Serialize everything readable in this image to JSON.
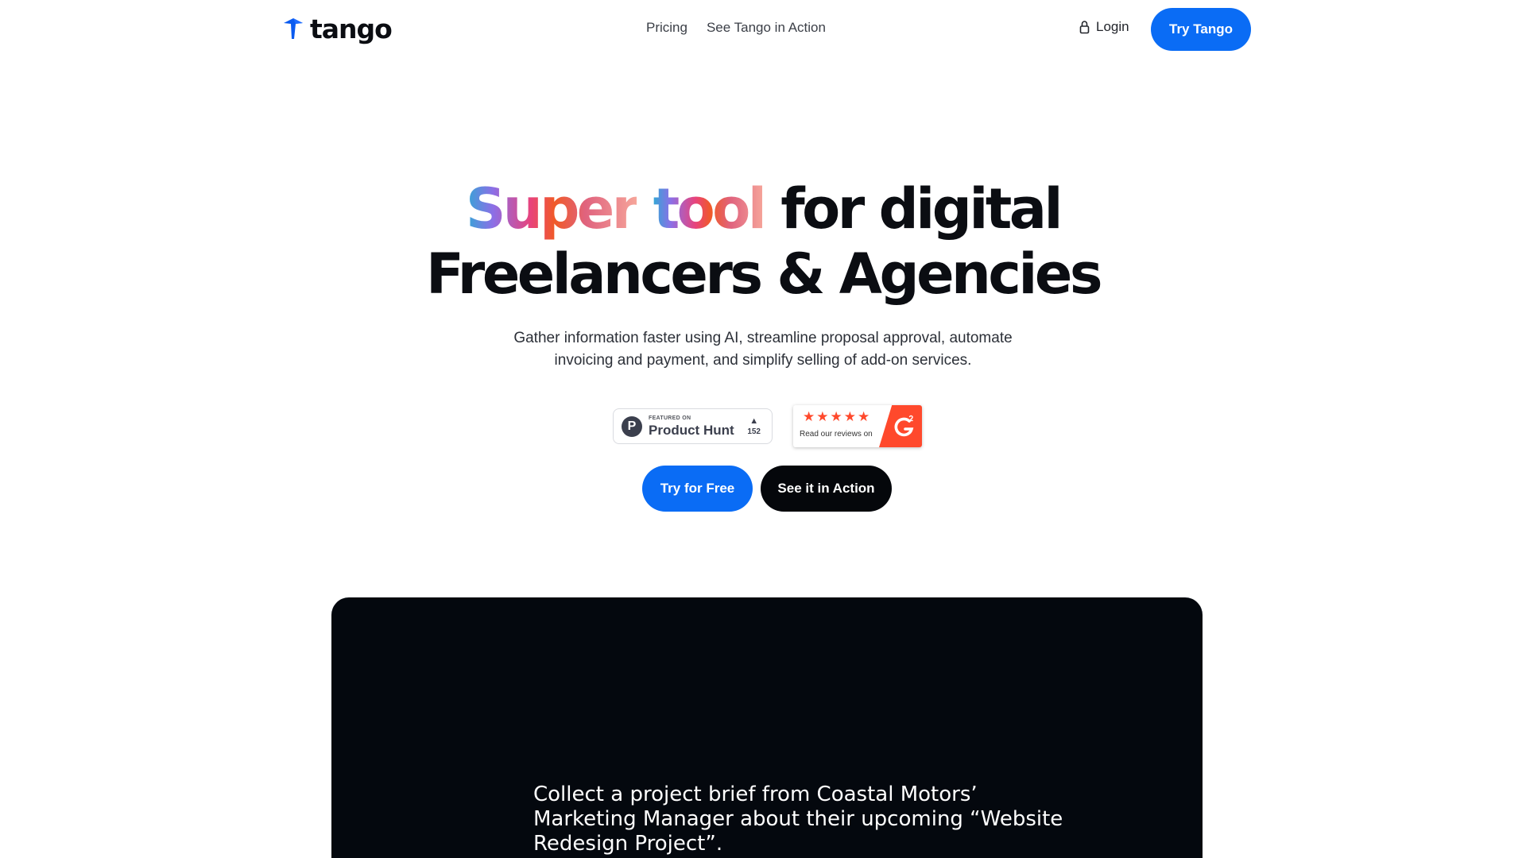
{
  "header": {
    "logo_text": "tango",
    "nav_links": [
      {
        "label": "Pricing"
      },
      {
        "label": "See Tango in Action"
      }
    ],
    "login_label": "Login",
    "cta_label": "Try Tango"
  },
  "hero": {
    "title_gradient_word1": "Super",
    "title_gradient_word2": "tool",
    "title_line1_rest": "for digital",
    "title_line2": "Freelancers & Agencies",
    "subtitle_line1": "Gather information faster using AI, streamline proposal approval, automate",
    "subtitle_line2": "invoicing and payment, and simplify selling of add-on services."
  },
  "badges": {
    "product_hunt": {
      "letter": "P",
      "featured_label": "FEATURED ON",
      "name": "Product Hunt",
      "upvotes": "152"
    },
    "g2": {
      "rating_stars": 5,
      "read_label": "Read our reviews on"
    }
  },
  "cta": {
    "primary_label": "Try for Free",
    "secondary_label": "See it in Action"
  },
  "demo": {
    "caption_line1": "Collect a project brief from Coastal Motors’",
    "caption_line2": "Marketing Manager about their upcoming “Website",
    "caption_line3": "Redesign Project”."
  },
  "colors": {
    "accent_blue": "#0a6cf5",
    "dark": "#05070b",
    "g2_red": "#ff492c"
  }
}
